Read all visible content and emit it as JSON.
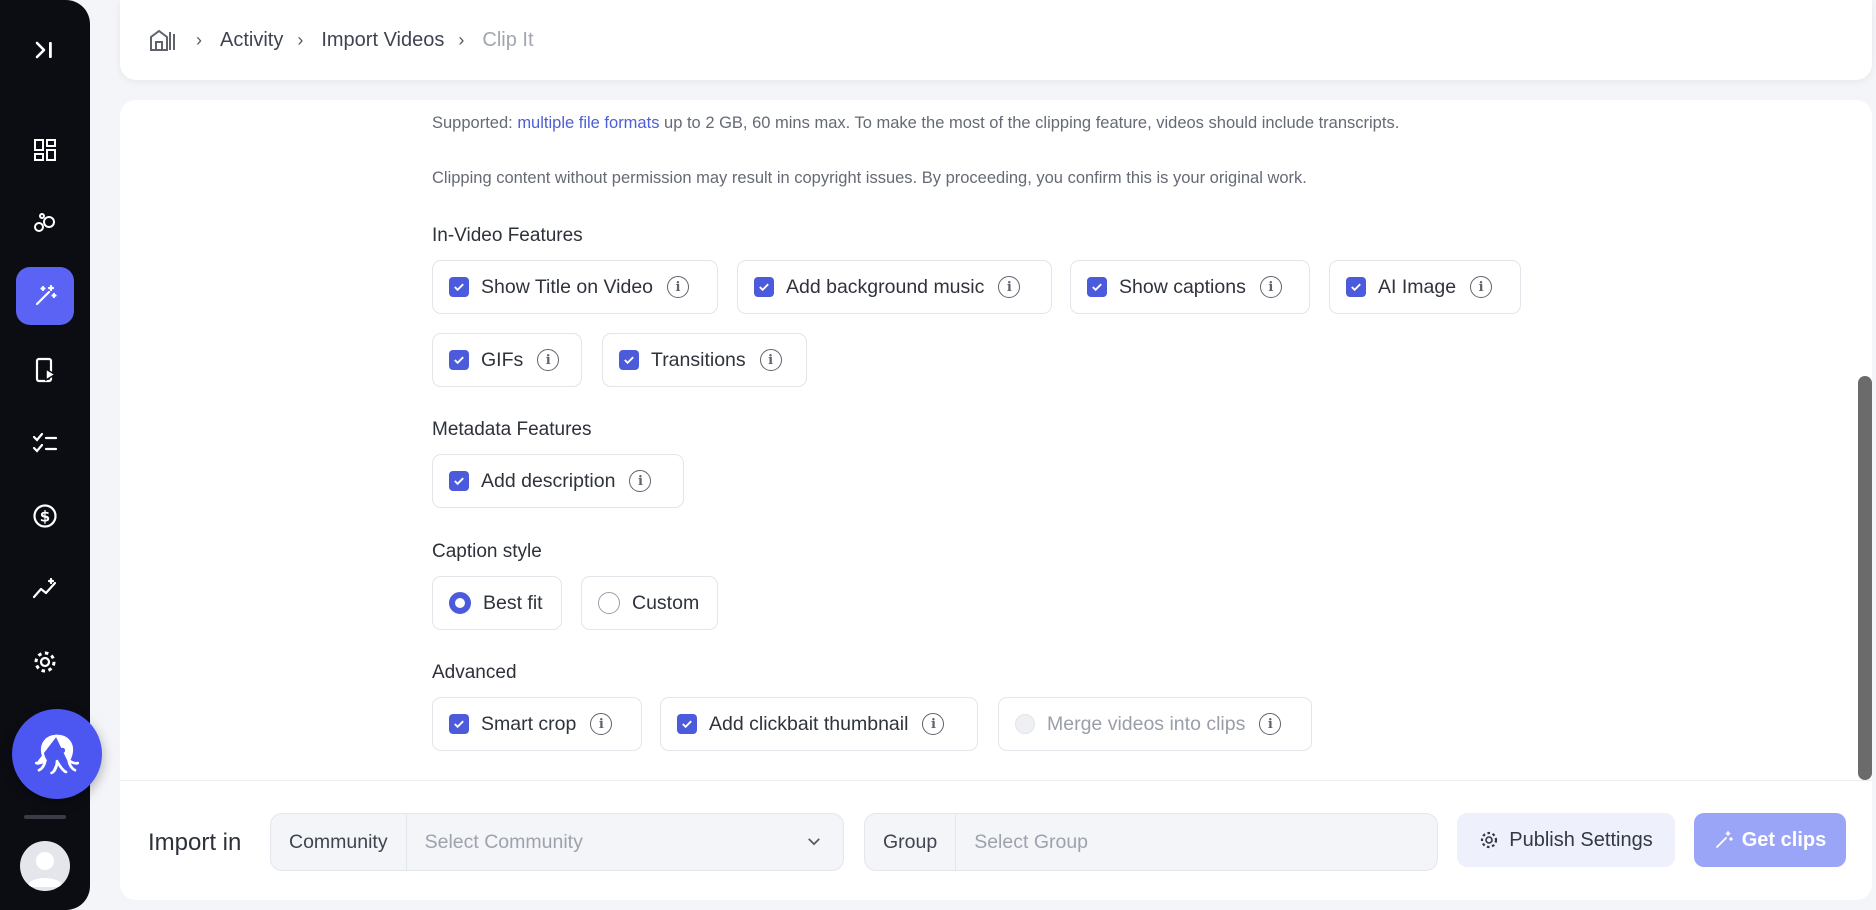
{
  "breadcrumb": {
    "items": [
      "Activity",
      "Import Videos",
      "Clip It"
    ]
  },
  "notes": {
    "supported_prefix": "Supported: ",
    "supported_link": "multiple file formats",
    "supported_suffix": " up to 2 GB, 60 mins max. To make the most of the clipping feature, videos should include transcripts.",
    "copyright": "Clipping content without permission may result in copyright issues. By proceeding, you confirm this is your original work."
  },
  "in_video": {
    "title": "In-Video Features",
    "options": [
      "Show Title on Video",
      "Add background music",
      "Show captions",
      "AI Image",
      "GIFs",
      "Transitions"
    ]
  },
  "metadata": {
    "title": "Metadata Features",
    "options": [
      "Add description"
    ]
  },
  "caption": {
    "title": "Caption style",
    "options": [
      "Best fit",
      "Custom"
    ],
    "selected": "Best fit"
  },
  "advanced": {
    "title": "Advanced",
    "options": [
      "Smart crop",
      "Add clickbait thumbnail",
      "Merge videos into clips"
    ]
  },
  "footer": {
    "import_in": "Import in",
    "community_label": "Community",
    "community_placeholder": "Select Community",
    "group_label": "Group",
    "group_placeholder": "Select Group",
    "publish_settings": "Publish Settings",
    "get_clips": "Get clips"
  },
  "colors": {
    "accent": "#4c5bdc",
    "sidebar": "#0b0d13",
    "get_clips": "#9aa5f8"
  }
}
